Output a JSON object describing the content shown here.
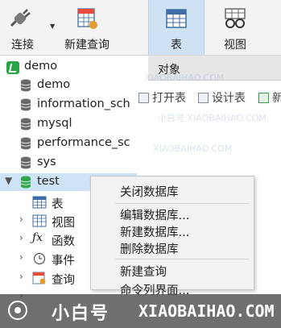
{
  "toolbar": {
    "connect_label": "连接",
    "new_query_label": "新建查询",
    "table_label": "表",
    "view_label": "视图"
  },
  "object_tab": {
    "label": "对象"
  },
  "object_tools": {
    "open_table": "打开表",
    "design_table": "设计表",
    "new_truncated": "新"
  },
  "tree": {
    "connection": "demo",
    "databases": [
      "demo",
      "information_sch",
      "mysql",
      "performance_sc",
      "sys",
      "test"
    ],
    "test_children": [
      "表",
      "视图",
      "函数",
      "事件",
      "查询"
    ]
  },
  "context_menu": {
    "items": [
      "关闭数据库",
      "编辑数据库...",
      "新建数据库...",
      "删除数据库",
      "新建查询",
      "命令列界面..."
    ]
  },
  "watermark": {
    "cn": "小白号",
    "en": "XIAOBAIHAO.COM"
  },
  "colors": {
    "selected_bg": "#cde3f6",
    "db_icon": "#6a6a6a",
    "connection_icon": "#27a645",
    "test_db_icon": "#2fa84f"
  }
}
